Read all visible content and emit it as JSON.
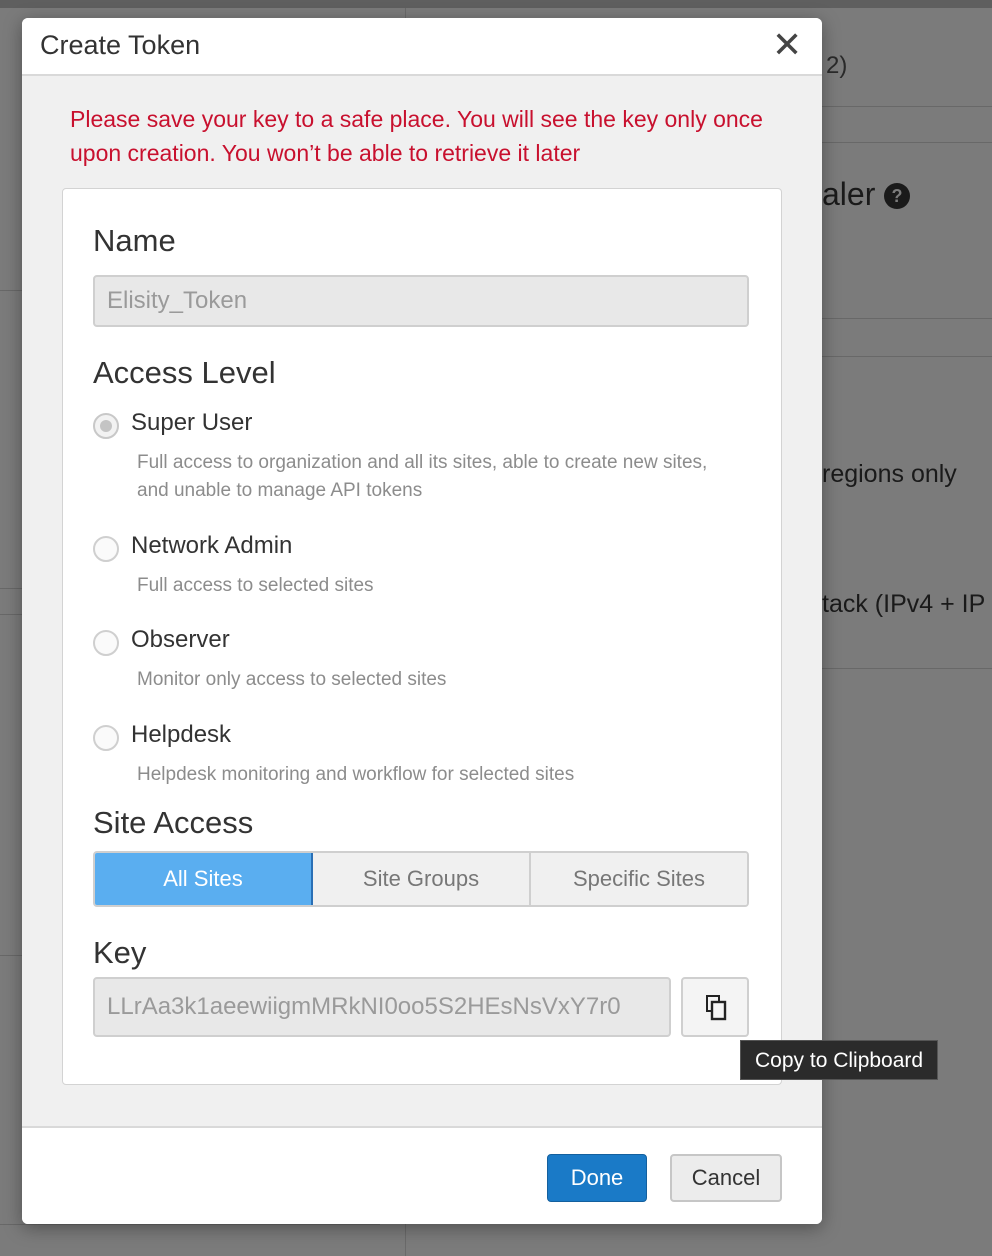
{
  "background": {
    "fragments": {
      "top_right": "2)",
      "heading_right": "aler",
      "regions": "regions only",
      "stack": "tack (IPv4 + IP"
    }
  },
  "modal": {
    "title": "Create Token",
    "close_symbol": "✕",
    "warning": "Please save your key to a safe place. You will see the key only once upon creation. You won’t be able to retrieve it later",
    "name": {
      "label": "Name",
      "value": "Elisity_Token"
    },
    "access_level": {
      "label": "Access Level",
      "options": [
        {
          "label": "Super User",
          "description": "Full access to organization and all its sites, able to create new sites, and unable to manage API tokens",
          "checked": true
        },
        {
          "label": "Network Admin",
          "description": "Full access to selected sites",
          "checked": false
        },
        {
          "label": "Observer",
          "description": "Monitor only access to selected sites",
          "checked": false
        },
        {
          "label": "Helpdesk",
          "description": "Helpdesk monitoring and workflow for selected sites",
          "checked": false
        }
      ]
    },
    "site_access": {
      "label": "Site Access",
      "options": [
        "All Sites",
        "Site Groups",
        "Specific Sites"
      ],
      "selected": "All Sites"
    },
    "key": {
      "label": "Key",
      "value": "LLrAa3k1aeewiigmMRkNI0oo5S2HEsNsVxY7r0"
    },
    "copy_tooltip": "Copy to Clipboard",
    "buttons": {
      "done": "Done",
      "cancel": "Cancel"
    },
    "colors": {
      "warning": "#c8102e",
      "primary": "#1a7ac7",
      "segment_active": "#5aaef0"
    }
  }
}
